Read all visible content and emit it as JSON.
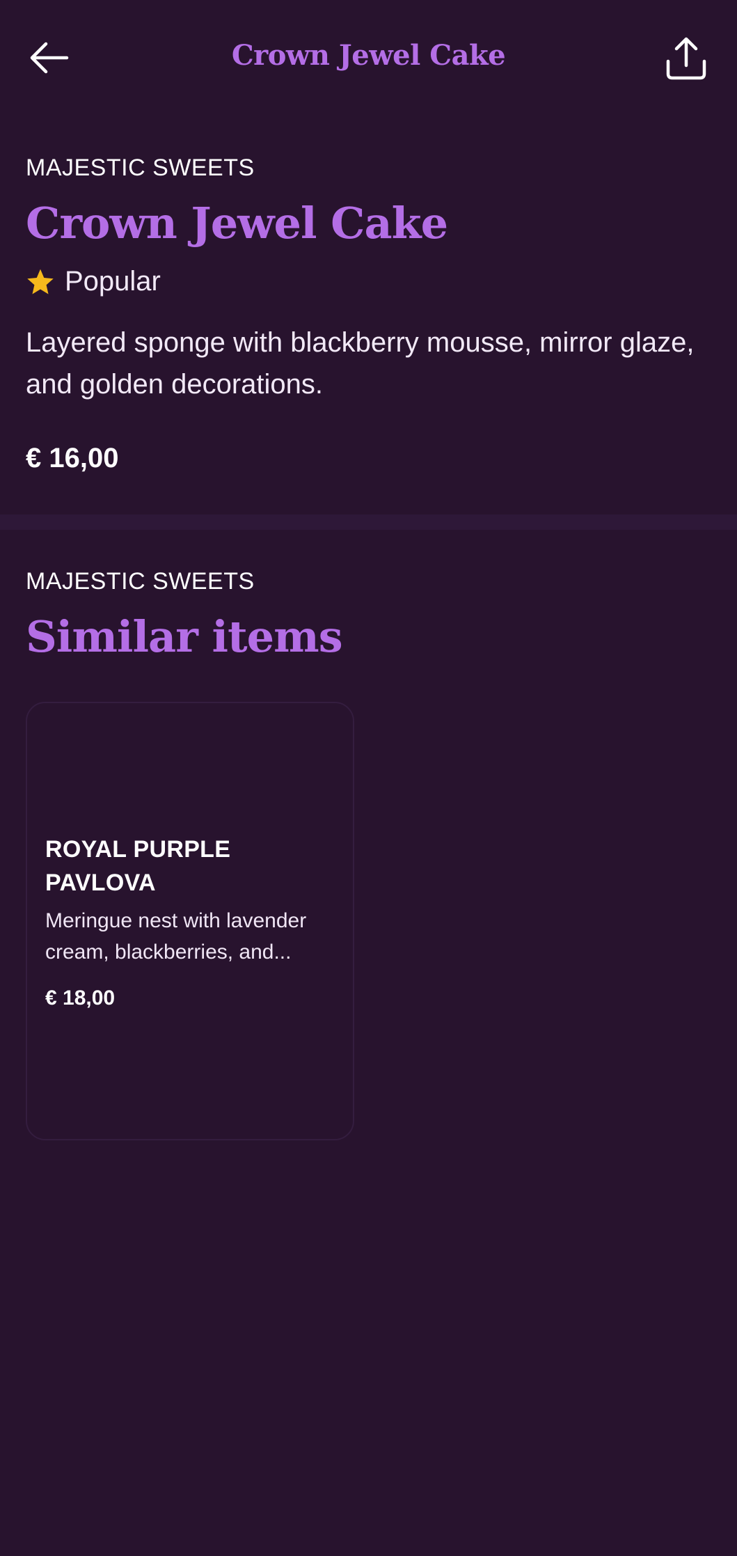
{
  "header": {
    "title": "Crown Jewel Cake",
    "back_icon": "arrow-left-icon",
    "share_icon": "share-icon"
  },
  "product": {
    "brand": "MAJESTIC SWEETS",
    "name": "Crown Jewel Cake",
    "badge_icon": "star-icon",
    "badge": "Popular",
    "description": "Layered sponge with blackberry mousse, mirror glaze, and golden decorations.",
    "price": "€ 16,00"
  },
  "similar": {
    "brand": "MAJESTIC SWEETS",
    "title": "Similar items",
    "items": [
      {
        "name": "ROYAL PURPLE PAVLOVA",
        "description": "Meringue nest with lavender cream, blackberries, and...",
        "price": "€ 18,00"
      }
    ]
  },
  "colors": {
    "background": "#28132e",
    "accent": "#b46ee6",
    "star": "#f5b81c"
  }
}
